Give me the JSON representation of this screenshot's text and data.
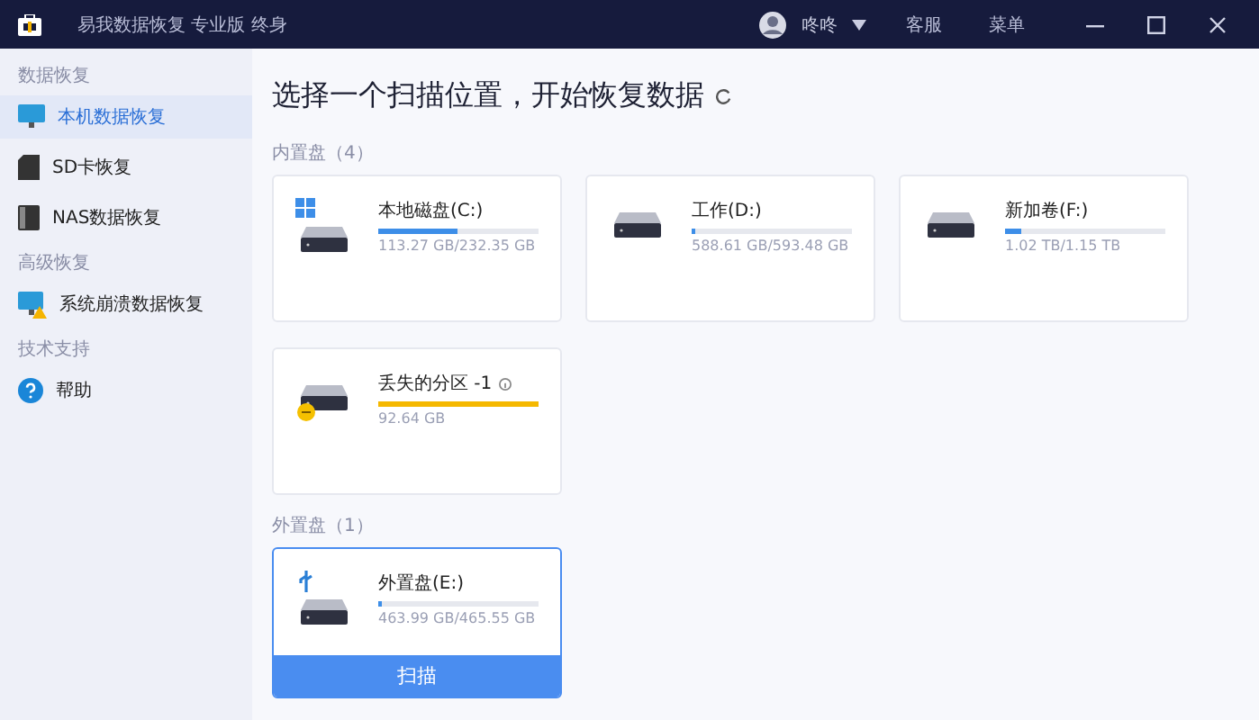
{
  "window": {
    "title": "易我数据恢复 专业版 终身",
    "user": "咚咚",
    "actions": [
      "客服",
      "菜单"
    ]
  },
  "sidebar": {
    "sections": [
      {
        "label": "数据恢复",
        "items": [
          {
            "label": "本机数据恢复",
            "kind": "pc",
            "selected": true
          },
          {
            "label": "SD卡恢复",
            "kind": "sd",
            "selected": false
          },
          {
            "label": "NAS数据恢复",
            "kind": "nas",
            "selected": false
          }
        ]
      },
      {
        "label": "高级恢复",
        "items": [
          {
            "label": "系统崩溃数据恢复",
            "kind": "crash",
            "selected": false
          }
        ]
      },
      {
        "label": "技术支持",
        "items": [
          {
            "label": "帮助",
            "kind": "help",
            "selected": false
          }
        ]
      }
    ]
  },
  "main": {
    "heading": "选择一个扫描位置，开始恢复数据",
    "groups": [
      {
        "label": "内置盘（4）",
        "disks": [
          {
            "name": "本地磁盘(C:)",
            "kind": "system",
            "size": "113.27 GB/232.35 GB",
            "level": 0.49,
            "selected": false
          },
          {
            "name": "工作(D:)",
            "kind": "normal",
            "size": "588.61 GB/593.48 GB",
            "level": 0.02,
            "selected": false
          },
          {
            "name": "新加卷(F:)",
            "kind": "normal",
            "size": "1.02 TB/1.15 TB",
            "level": 0.1,
            "selected": false
          },
          {
            "name": "丢失的分区 -1",
            "kind": "lost",
            "size": "92.64 GB",
            "level": 1,
            "selected": false
          }
        ]
      },
      {
        "label": "外置盘（1）",
        "disks": [
          {
            "name": "外置盘(E:)",
            "kind": "usb",
            "size": "463.99 GB/465.55 GB",
            "level": 0.02,
            "selected": true,
            "action": "扫描"
          }
        ]
      }
    ]
  }
}
